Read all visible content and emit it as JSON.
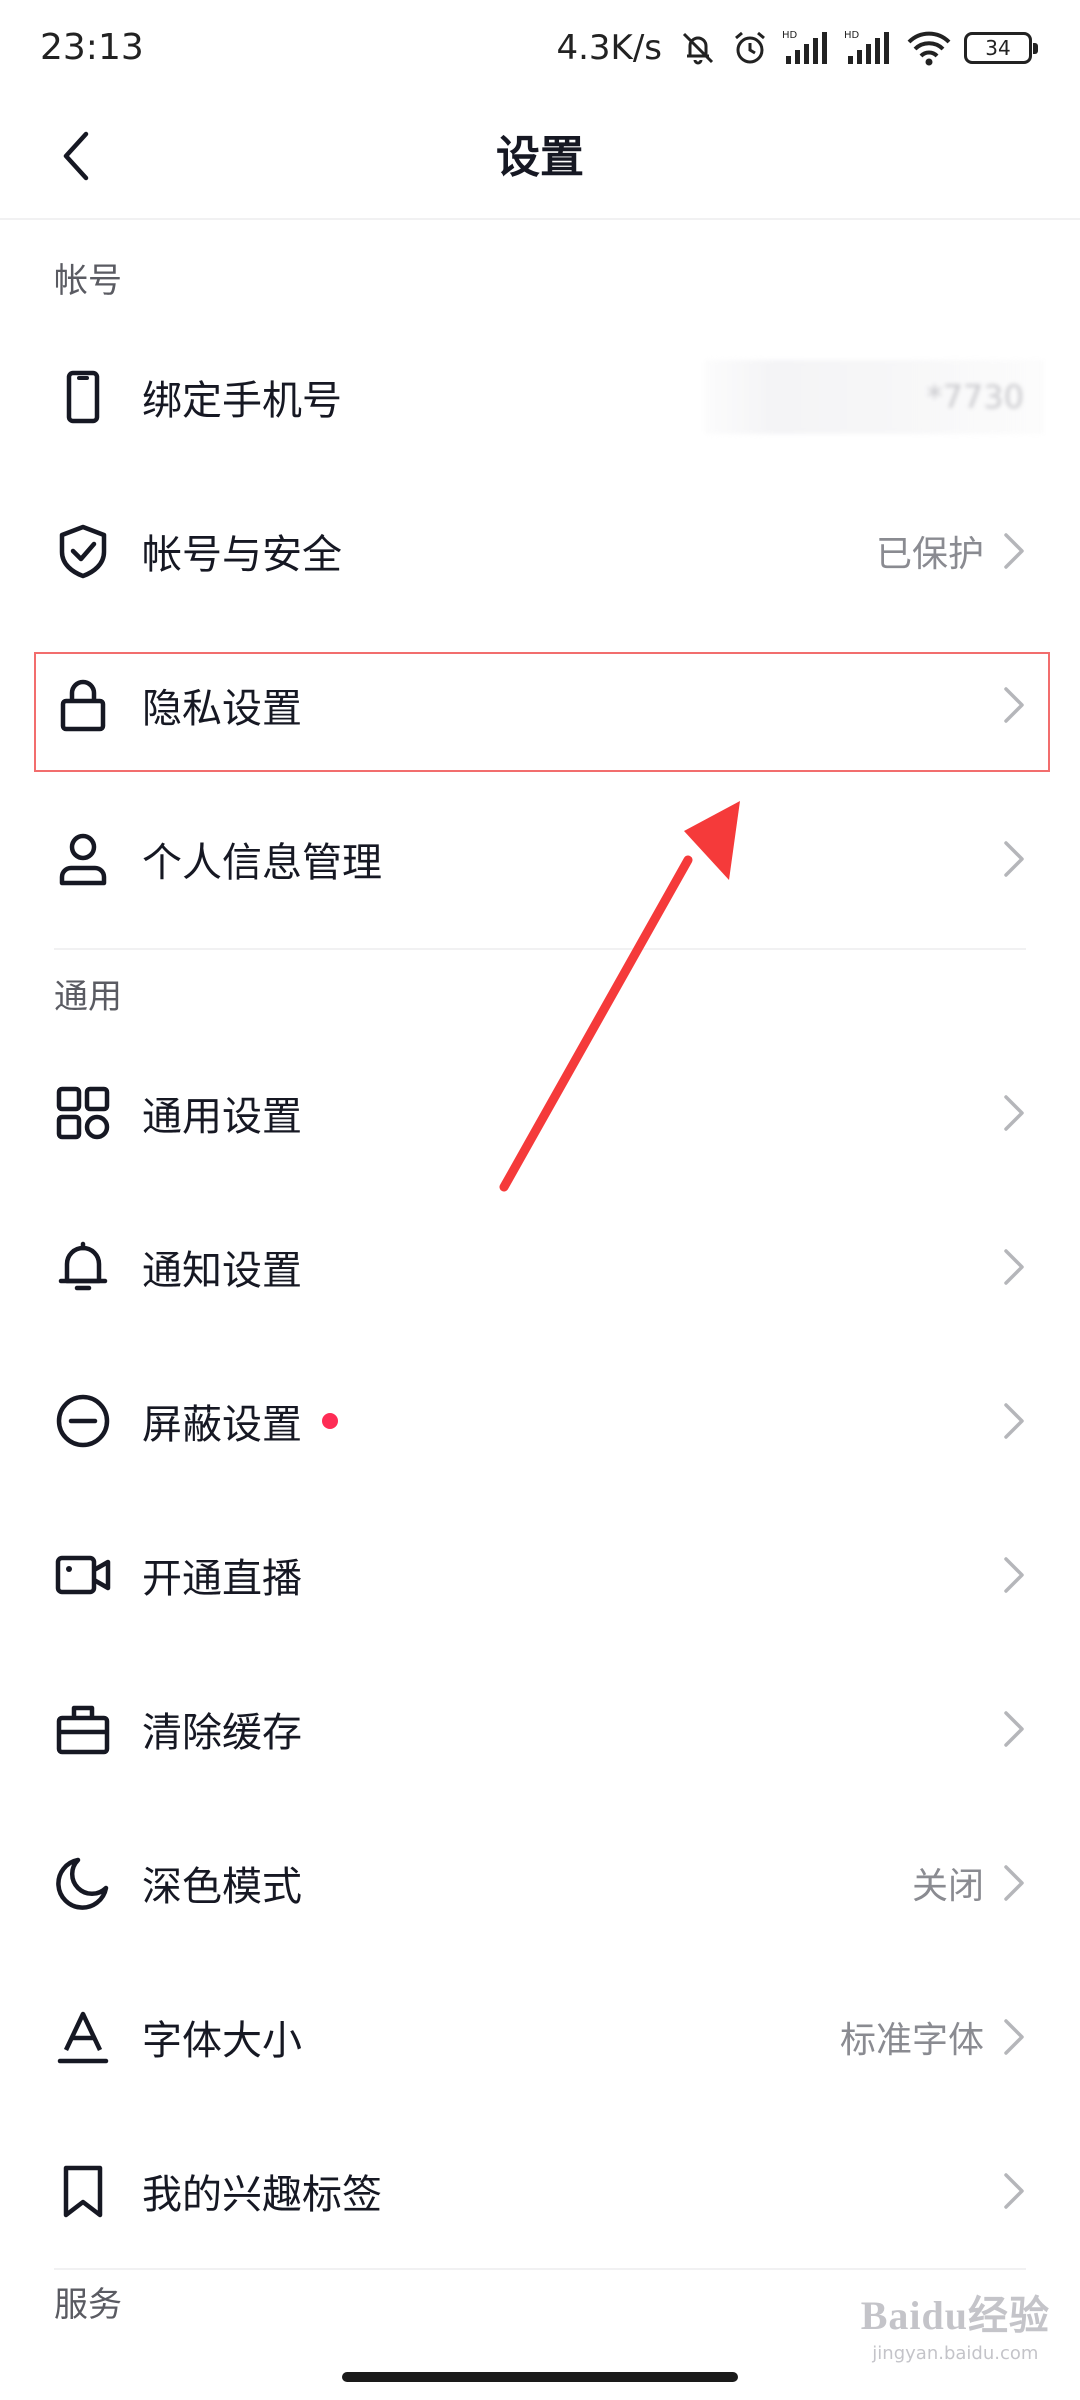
{
  "status_bar": {
    "time": "23:13",
    "net_speed": "4.3K/s",
    "battery": "34"
  },
  "header": {
    "title": "设置"
  },
  "sections": [
    {
      "title": "帐号",
      "items": [
        {
          "icon": "phone-icon",
          "label": "绑定手机号",
          "value": "*7730"
        },
        {
          "icon": "shield-check-icon",
          "label": "帐号与安全",
          "value": "已保护"
        },
        {
          "icon": "lock-icon",
          "label": "隐私设置",
          "value": ""
        },
        {
          "icon": "person-icon",
          "label": "个人信息管理",
          "value": ""
        }
      ]
    },
    {
      "title": "通用",
      "items": [
        {
          "icon": "grid-icon",
          "label": "通用设置",
          "value": ""
        },
        {
          "icon": "bell-icon",
          "label": "通知设置",
          "value": ""
        },
        {
          "icon": "minus-circle-icon",
          "label": "屏蔽设置",
          "value": "",
          "badge": "red-dot"
        },
        {
          "icon": "video-camera-icon",
          "label": "开通直播",
          "value": ""
        },
        {
          "icon": "clear-cache-icon",
          "label": "清除缓存",
          "value": ""
        },
        {
          "icon": "moon-icon",
          "label": "深色模式",
          "value": "关闭"
        },
        {
          "icon": "font-size-icon",
          "label": "字体大小",
          "value": "标准字体"
        },
        {
          "icon": "bookmark-icon",
          "label": "我的兴趣标签",
          "value": ""
        }
      ]
    },
    {
      "title": "服务",
      "items": []
    }
  ],
  "watermark": {
    "main": "Baidu经验",
    "sub": "jingyan.baidu.com"
  },
  "colors": {
    "text_primary": "#161823",
    "text_secondary": "#8a8b91",
    "accent_dot": "#fe2c55",
    "highlight_box": "#f26d6d",
    "annotation_arrow": "#f53a3a"
  }
}
